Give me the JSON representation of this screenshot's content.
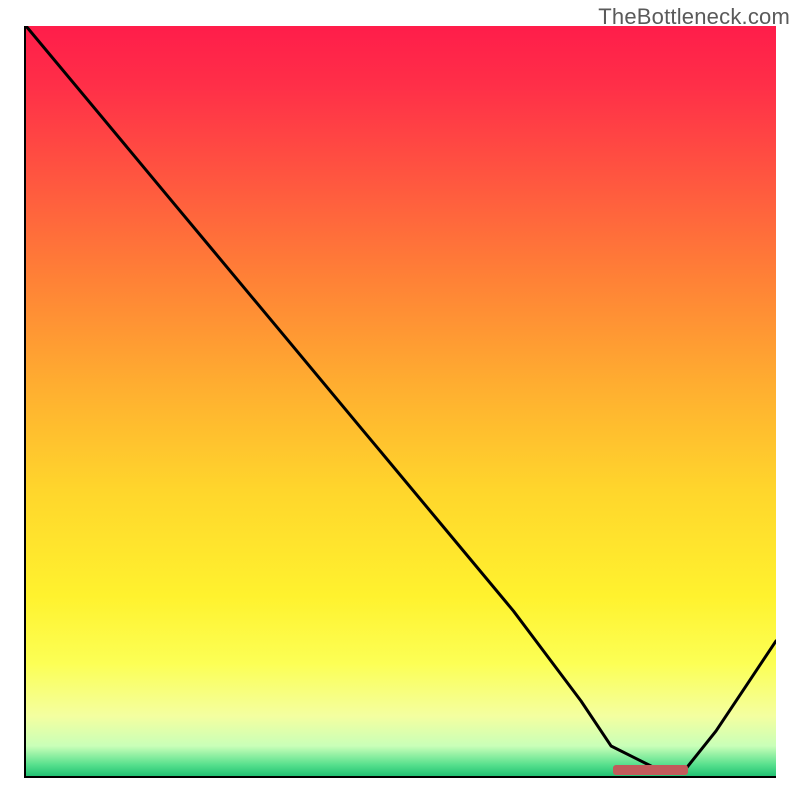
{
  "watermark": "TheBottleneck.com",
  "chart_data": {
    "type": "line",
    "title": "",
    "xlabel": "",
    "ylabel": "",
    "xlim": [
      0,
      100
    ],
    "ylim": [
      0,
      100
    ],
    "x": [
      0,
      10,
      20,
      25,
      35,
      45,
      55,
      65,
      74,
      78,
      84,
      88,
      92,
      96,
      100
    ],
    "values": [
      100,
      88,
      76,
      70,
      58,
      46,
      34,
      22,
      10,
      4,
      1,
      1,
      6,
      12,
      18
    ],
    "minimum_band": {
      "x_start": 78,
      "x_end": 88,
      "y": 1
    },
    "gradient_stops": [
      {
        "pos": 0,
        "color": "#ff1d4a"
      },
      {
        "pos": 0.5,
        "color": "#ffd62c"
      },
      {
        "pos": 0.9,
        "color": "#fcff55"
      },
      {
        "pos": 1.0,
        "color": "#22c173"
      }
    ]
  }
}
